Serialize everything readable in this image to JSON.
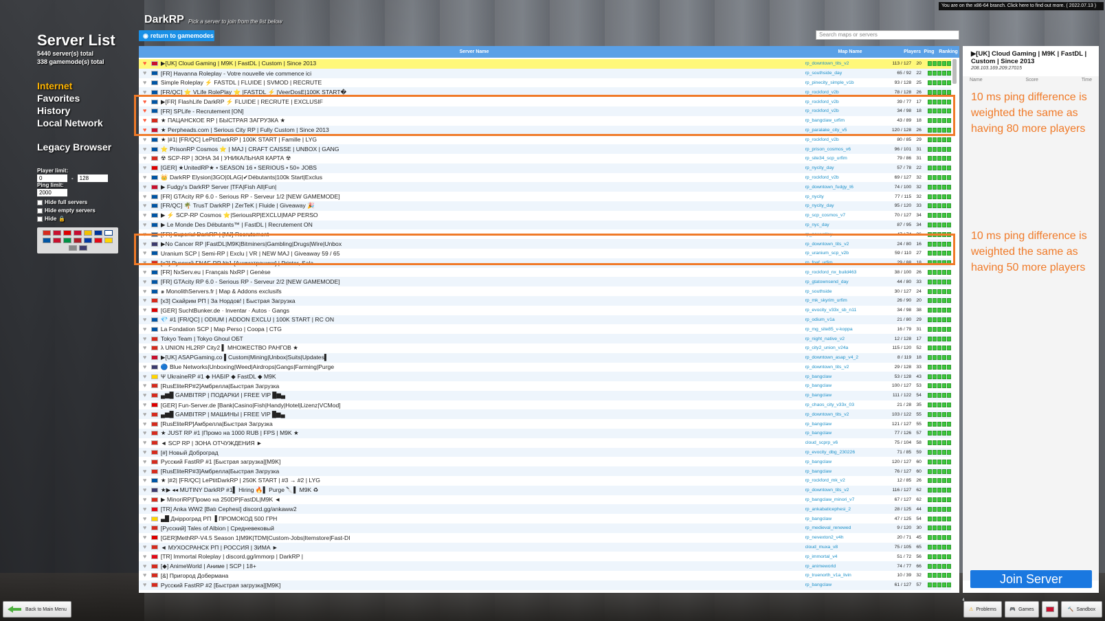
{
  "notice": "You are on the x86-64 branch. Click here to find out more. ( 2022.07.13 )",
  "sidebar": {
    "title": "Server List",
    "servers_total": "5440 server(s) total",
    "gamemodes_total": "338 gamemode(s) total",
    "nav": [
      "Internet",
      "Favorites",
      "History",
      "Local Network"
    ],
    "legacy": "Legacy Browser",
    "player_limit_label": "Player limit:",
    "player_min": "0",
    "player_max": "128",
    "ping_limit_label": "Ping limit:",
    "ping_value": "2000",
    "hide_full": "Hide full servers",
    "hide_empty": "Hide empty servers",
    "hide_locked": "Hide"
  },
  "header": {
    "title": "DarkRP",
    "subtitle": "Pick a server to join from the list below",
    "return_label": "return to gamemodes",
    "search_placeholder": "Search maps or servers"
  },
  "table": {
    "columns": [
      "Server Name",
      "Map Name",
      "Players",
      "Ping",
      "Ranking"
    ],
    "rows": [
      {
        "name": "▶[UK] Cloud Gaming | M9K | FastDL | Custom | Since 2013",
        "map": "rp_downtown_tits_v2",
        "players": "113 / 127",
        "ping": "20",
        "fav": true,
        "flag": "#c8102e"
      },
      {
        "name": "[FR] Havanna Roleplay - Votre nouvelle vie commence ici",
        "map": "rp_southside_day",
        "players": "65 / 92",
        "ping": "22",
        "fav": false,
        "flag": "#0055a4"
      },
      {
        "name": "Simple Roleplay ⚡ FASTDL | FLUIDE | SVMOD | RECRUTE",
        "map": "rp_pinecity_simple_v1b",
        "players": "93 / 128",
        "ping": "25",
        "fav": false,
        "flag": "#0055a4"
      },
      {
        "name": "[FR/QC] ⭐ VLife RolePlay ⭐ |FASTDL ⚡ |VeerDosE|100K START�",
        "map": "rp_rockford_v2b",
        "players": "78 / 128",
        "ping": "26",
        "fav": false,
        "flag": "#0055a4"
      },
      {
        "name": "▶[FR] FlashLife DarkRP ⚡ FLUIDE | RECRUTE | EXCLUSIF",
        "map": "rp_rockford_v2b",
        "players": "39 / 77",
        "ping": "17",
        "fav": true,
        "flag": "#0055a4"
      },
      {
        "name": "[FR] SPLife - Recrutement [ON]",
        "map": "rp_rockford_v2b",
        "players": "34 / 98",
        "ping": "18",
        "fav": true,
        "flag": "#0055a4"
      },
      {
        "name": "★ ПАЦАНСКОЕ RP | БЫСТРАЯ ЗАГРУЗКА ★",
        "map": "rp_bangclaw_urfim",
        "players": "43 / 89",
        "ping": "18",
        "fav": true,
        "flag": "#d52b1e"
      },
      {
        "name": "★ Perpheads.com | Serious City RP | Fully Custom | Since 2013",
        "map": "rp_paralake_city_v5",
        "players": "120 / 128",
        "ping": "26",
        "fav": true,
        "flag": "#c8102e"
      },
      {
        "name": "★ |#1| [FR/QC] LePtitDarkRP | 100K START | Famille | LYG",
        "map": "rp_rockford_v2b",
        "players": "80 / 85",
        "ping": "29",
        "fav": false,
        "flag": "#0055a4"
      },
      {
        "name": "⭐ PrisonRP Cosmos ⭐ | MAJ | CRAFT CAISSE | UNBOX | GANG",
        "map": "rp_prison_cosmos_v6",
        "players": "96 / 101",
        "ping": "31",
        "fav": false,
        "flag": "#0055a4"
      },
      {
        "name": "☢ SCP-RP | ЗОНА 34 | УНИКАЛЬНАЯ КАРТА ☢",
        "map": "rp_site34_scp_urfim",
        "players": "79 / 86",
        "ping": "31",
        "fav": false,
        "flag": "#d52b1e"
      },
      {
        "name": "[GER] ★UnitedRP★ • SEASON 16 • SERIOUS • 50+ JOBS",
        "map": "rp_nycity_day",
        "players": "57 / 78",
        "ping": "22",
        "fav": false,
        "flag": "#dd0000"
      },
      {
        "name": "👑 DarkRP Elysion|3GO|0LAG|✔Débutants|100k Start|Exclus",
        "map": "rp_rockford_v2b",
        "players": "69 / 127",
        "ping": "32",
        "fav": false,
        "flag": "#0055a4"
      },
      {
        "name": "▶ Fudgy's DarkRP Server |TFA|Fish All|Fun|",
        "map": "rp_downtown_fudgy_t6",
        "players": "74 / 100",
        "ping": "32",
        "fav": false,
        "flag": "#c8102e"
      },
      {
        "name": "[FR] GTAcity RP 6.0 - Serious RP - Serveur 1/2 [NEW GAMEMODE]",
        "map": "rp_nycity",
        "players": "77 / 115",
        "ping": "32",
        "fav": false,
        "flag": "#0055a4"
      },
      {
        "name": "[FR/QC] 🌴 TrusT DarkRP | ZerTeK | Fluide | Giveaway 🎉",
        "map": "rp_nycity_day",
        "players": "95 / 120",
        "ping": "33",
        "fav": false,
        "flag": "#0055a4"
      },
      {
        "name": "▶ ⚡ SCP-RP Cosmos ⭐|SeriousRP|EXCLU|MAP PERSO",
        "map": "rp_scp_cosmos_v7",
        "players": "70 / 127",
        "ping": "34",
        "fav": false,
        "flag": "#0055a4"
      },
      {
        "name": "▶ Le Monde Des Débutants™ | FastDL | Recrutement ON",
        "map": "rp_nyc_day",
        "players": "87 / 95",
        "ping": "34",
        "fav": false,
        "flag": "#0055a4"
      },
      {
        "name": "[FR] Superiul DarkRP | [MJ] Recrutement",
        "map": "rp_newvalley",
        "players": "47 / 74",
        "ping": "36",
        "fav": false,
        "flag": "#0055a4"
      },
      {
        "name": "▶No Cancer RP |FastDL|M9K|Bitminers|Gambling|Drugs|Wire|Unbox",
        "map": "rp_downtown_tits_v2",
        "players": "24 / 80",
        "ping": "16",
        "fav": false,
        "flag": "#3c3b6e"
      },
      {
        "name": "Uranium SCP | Semi-RP | Exclu | VR | NEW MAJ | Giveaway 59 / 65",
        "map": "rp_uranium_scp_v2b",
        "players": "59 / 110",
        "ping": "27",
        "fav": false,
        "flag": "#0055a4"
      },
      {
        "name": "[x2] Русский FNAF-RP №1 [Аниматроники] | Printer, Sala",
        "map": "rp_fnaf_urfim",
        "players": "29 / 88",
        "ping": "18",
        "fav": false,
        "flag": "#d52b1e"
      },
      {
        "name": "[FR] NxServ.eu | Français NxRP | Genèse",
        "map": "rp_rockford_nx_build463",
        "players": "38 / 100",
        "ping": "26",
        "fav": false,
        "flag": "#0055a4"
      },
      {
        "name": "[FR] GTAcity RP 6.0 - Serious RP - Serveur 2/2 [NEW GAMEMODE]",
        "map": "rp_gtatownsend_day",
        "players": "44 / 80",
        "ping": "33",
        "fav": false,
        "flag": "#0055a4"
      },
      {
        "name": "๑ MonolithServers.fr | Map & Addons exclusifs",
        "map": "rp_southside",
        "players": "30 / 127",
        "ping": "24",
        "fav": false,
        "flag": "#0055a4"
      },
      {
        "name": "[x3] Скайрим РП | За Нордов! | Быстрая Загрузка",
        "map": "rp_mk_skyrim_urfim",
        "players": "26 / 90",
        "ping": "20",
        "fav": false,
        "flag": "#d52b1e"
      },
      {
        "name": "[GER] SuchtBunker.de · Inventar · Autos · Gangs",
        "map": "rp_evocity_v33x_sb_n11",
        "players": "34 / 98",
        "ping": "38",
        "fav": false,
        "flag": "#dd0000"
      },
      {
        "name": "💎 #1 [FR/QC] | ODIUM | ADDON EXCLU | 100K START | RC ON",
        "map": "rp_odium_v1a",
        "players": "21 / 80",
        "ping": "29",
        "fav": false,
        "flag": "#0055a4"
      },
      {
        "name": "La Fondation SCP | Map Perso | Coopa | CTG",
        "map": "rp_mg_site85_v-koppa",
        "players": "16 / 79",
        "ping": "31",
        "fav": false,
        "flag": "#0055a4"
      },
      {
        "name": "Tokyo Team | Tokyo Ghoul OБТ",
        "map": "rp_night_native_v2",
        "players": "12 / 128",
        "ping": "17",
        "fav": false,
        "flag": "#d52b1e"
      },
      {
        "name": "λ UNION HL2RP City2 ▌ МНОЖЕСТВО РАНГОВ ★",
        "map": "rp_city2_union_v24a",
        "players": "115 / 120",
        "ping": "52",
        "fav": false,
        "flag": "#d52b1e"
      },
      {
        "name": "▶[UK] ASAPGaming.co ▌Custom|Mining|Unbox|Suits|Updates▌",
        "map": "rp_downtown_asap_v4_2",
        "players": "8 / 119",
        "ping": "18",
        "fav": false,
        "flag": "#c8102e"
      },
      {
        "name": "🔵 Blue Networks|Unboxing|Weed|Airdrops|Gangs|Farming|Purge",
        "map": "rp_downtown_tits_v2",
        "players": "29 / 128",
        "ping": "33",
        "fav": false,
        "flag": "#3c3b6e"
      },
      {
        "name": "Ψ UkraineRP #1 ◆ НАБІР ◆ FastDL ◆ M9K",
        "map": "rp_bangclaw",
        "players": "53 / 128",
        "ping": "43",
        "fav": false,
        "flag": "#ffd500"
      },
      {
        "name": "[RusEliteRP#2]Амбрелла|Быстрая Загрузка",
        "map": "rp_bangclaw",
        "players": "100 / 127",
        "ping": "53",
        "fav": false,
        "flag": "#d52b1e"
      },
      {
        "name": "▄▆█ GAMBITRP | ПОДАРКИ | FREE VIP █▆▄",
        "map": "rp_bangclaw",
        "players": "111 / 122",
        "ping": "54",
        "fav": false,
        "flag": "#d52b1e"
      },
      {
        "name": "[GER] Fun-Server.de [Bank|Casino|Fish|Handy|Hotel|Lizenz|VCMod]",
        "map": "rp_chaos_city_v33x_03",
        "players": "21 / 28",
        "ping": "35",
        "fav": false,
        "flag": "#dd0000"
      },
      {
        "name": "▄▆█ GAMBITRP | МАШИНЫ | FREE VIP █▆▄",
        "map": "rp_downtown_tits_v2",
        "players": "103 / 122",
        "ping": "55",
        "fav": false,
        "flag": "#d52b1e"
      },
      {
        "name": "[RusEliteRP]Амбрелла|Быстрая Загрузка",
        "map": "rp_bangclaw",
        "players": "121 / 127",
        "ping": "55",
        "fav": false,
        "flag": "#d52b1e"
      },
      {
        "name": "★ JUST RP #1 |Промо на 1000 RUB | FPS | M9K ★",
        "map": "rp_bangclaw",
        "players": "77 / 126",
        "ping": "57",
        "fav": false,
        "flag": "#d52b1e"
      },
      {
        "name": "◄ SCP RP | ЗОНА ОТЧУЖДЕНИЯ ►",
        "map": "cloud_scprp_v6",
        "players": "75 / 104",
        "ping": "58",
        "fav": false,
        "flag": "#d52b1e"
      },
      {
        "name": "[#] Новый Доброград",
        "map": "rp_evocity_dbg_230226",
        "players": "71 / 85",
        "ping": "59",
        "fav": false,
        "flag": "#d52b1e"
      },
      {
        "name": "Русский FastRP #1 [Быстрая загрузка][M9K]",
        "map": "rp_bangclaw",
        "players": "120 / 127",
        "ping": "60",
        "fav": false,
        "flag": "#d52b1e"
      },
      {
        "name": "[RusEliteRP#3]Амбрелла|Быстрая Загрузка",
        "map": "rp_bangclaw",
        "players": "76 / 127",
        "ping": "60",
        "fav": false,
        "flag": "#d52b1e"
      },
      {
        "name": "★ |#2| [FR/QC] LePtitDarkRP | 250K START | #3 → #2 | LYG",
        "map": "rp_rockford_mk_v2",
        "players": "12 / 85",
        "ping": "26",
        "fav": false,
        "flag": "#0055a4"
      },
      {
        "name": "★▶ ◂◂ MUTINY DarkRP #1▌ Hiring 🔥▌ Purge 🔪▌ M9K ♻",
        "map": "rp_downtown_tits_v2",
        "players": "116 / 127",
        "ping": "62",
        "fav": false,
        "flag": "#3c3b6e"
      },
      {
        "name": "▶ MinorіRP|Промо на 250DP|FastDL|M9K ◄",
        "map": "rp_bangclaw_minori_v7",
        "players": "67 / 127",
        "ping": "62",
        "fav": false,
        "flag": "#d52b1e"
      },
      {
        "name": "[TR] Anka WW2 [Batı Cephesi] discord.gg/ankaww2",
        "map": "rp_ankabaticephesi_2",
        "players": "28 / 125",
        "ping": "44",
        "fav": false,
        "flag": "#e30a17"
      },
      {
        "name": "▄█ Днipроград РП ▐ ПРОМОКОД 500 ГРН",
        "map": "rp_bangclaw",
        "players": "47 / 125",
        "ping": "54",
        "fav": false,
        "flag": "#ffd500"
      },
      {
        "name": "[Русский] Tales of Albion | Средневековый",
        "map": "rp_medieval_renewed",
        "players": "9 / 120",
        "ping": "30",
        "fav": false,
        "flag": "#d52b1e"
      },
      {
        "name": "[GER]MethRP-V4.5 Season 1|M9K|TDM|Custom-Jobs|Itemstore|Fast-DI",
        "map": "rp_nevexton2_v4h",
        "players": "20 / 71",
        "ping": "45",
        "fav": false,
        "flag": "#dd0000"
      },
      {
        "name": "◄ МУХОСРАНСК РП | РОССИЯ | ЗИМА ►",
        "map": "cloud_muxa_v8",
        "players": "75 / 105",
        "ping": "65",
        "fav": false,
        "flag": "#d52b1e"
      },
      {
        "name": "[TR] Immortal Roleplay | discord.gg/immorp | DarkRP |",
        "map": "rp_immortal_v4",
        "players": "51 / 72",
        "ping": "56",
        "fav": false,
        "flag": "#e30a17"
      },
      {
        "name": "[◆] AnimeWorld | Аниме | SCP | 18+",
        "map": "rp_animeworld",
        "players": "74 / 77",
        "ping": "66",
        "fav": false,
        "flag": "#d52b1e"
      },
      {
        "name": "[&] Пригород Добермана",
        "map": "rp_truenorth_v1a_livin",
        "players": "10 / 39",
        "ping": "32",
        "fav": false,
        "flag": "#d52b1e"
      },
      {
        "name": "Русский FastRP #2 [Быстрая загрузка][M9K]",
        "map": "rp_bangclaw",
        "players": "61 / 127",
        "ping": "57",
        "fav": false,
        "flag": "#d52b1e"
      }
    ]
  },
  "details": {
    "name": "▶[UK] Cloud Gaming | M9K | FastDL | Custom | Since 2013",
    "ip": "208.103.169.209:27015",
    "cols": [
      "Name",
      "Score",
      "Time"
    ],
    "join_label": "Join Server"
  },
  "annotations": {
    "top": "10 ms ping difference is weighted the same as having 80 more players",
    "bottom": "10 ms ping difference is weighted the same as having 50 more players"
  },
  "bottom_bar": {
    "back_label": "Back to Main Menu",
    "badge": "4",
    "problems": "Problems",
    "games": "Games",
    "sandbox": "Sandbox"
  }
}
